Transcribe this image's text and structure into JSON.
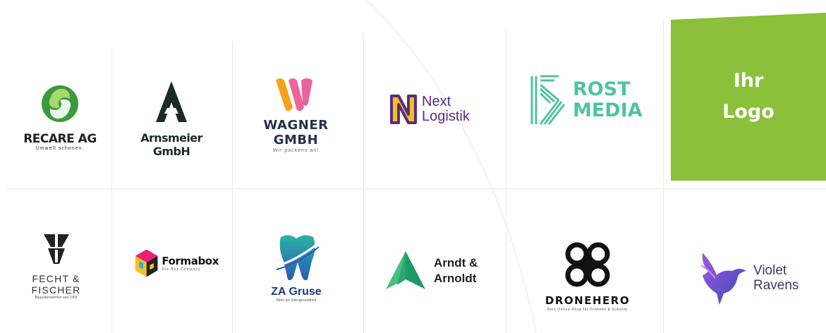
{
  "logos": {
    "recare": {
      "name": "RECARE AG",
      "tagline": "Umwelt schonen."
    },
    "arnsmeier": {
      "name": "Arnsmeier GmbH"
    },
    "wagner": {
      "name": "WAGNER GMBH",
      "tagline": "Wir packens an!"
    },
    "next": {
      "line1": "Next",
      "line2": "Logistik"
    },
    "rost": {
      "line1": "ROST",
      "line2": "MEDIA"
    },
    "ihr": {
      "line1": "Ihr",
      "line2": "Logo"
    },
    "fecht": {
      "name": "FECHT & FISCHER",
      "tagline": "Bauunternehmen seit 1959"
    },
    "formabox": {
      "name": "Formabox",
      "tagline": "Die Box Company"
    },
    "zagruse": {
      "name": "ZA Gruse",
      "tagline": "Mehr als Zahngesundheit"
    },
    "arndt": {
      "line1": "Arndt &",
      "line2": "Arnoldt"
    },
    "dronehero": {
      "name": "DRONEHERO",
      "tagline": "Dein Online-Shop für Drohnen & Zubehör"
    },
    "violet": {
      "line1": "Violet",
      "line2": "Ravens"
    }
  },
  "colors": {
    "recare_green": "#3c9a3e",
    "wagner_navy": "#24324c",
    "next_purple": "#5a2a86",
    "next_yellow": "#f2c11a",
    "rost_teal": "#4fc3a1",
    "ihr_green": "#8cbf3a",
    "arndt_green": "#1e9a6a",
    "violet_purple": "#6a3fb8"
  }
}
